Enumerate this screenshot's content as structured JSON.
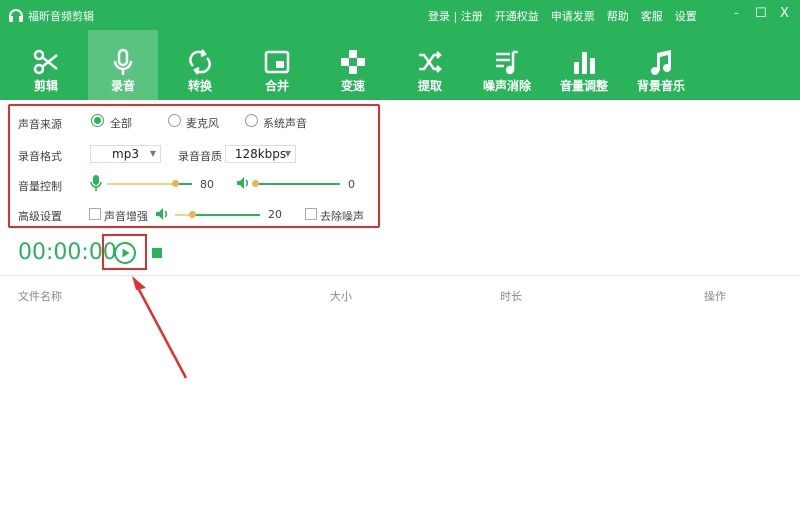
{
  "app": {
    "title": "福昕音频剪辑"
  },
  "header_links": [
    "登录 | 注册",
    "开通权益",
    "申请发票",
    "帮助",
    "客服",
    "设置"
  ],
  "window_controls": {
    "minimize": "-",
    "maximize": "☐",
    "close": "X"
  },
  "tabs": [
    {
      "label": "剪辑"
    },
    {
      "label": "录音"
    },
    {
      "label": "转换"
    },
    {
      "label": "合并"
    },
    {
      "label": "变速"
    },
    {
      "label": "提取"
    },
    {
      "label": "噪声消除"
    },
    {
      "label": "音量调整"
    },
    {
      "label": "背景音乐"
    }
  ],
  "settings": {
    "source": {
      "label": "声音来源",
      "options": [
        "全部",
        "麦克风",
        "系统声音"
      ],
      "selected": "全部"
    },
    "format": {
      "label": "录音格式",
      "value": "mp3",
      "quality_label": "录音音质",
      "quality_value": "128kbps"
    },
    "volume": {
      "label": "音量控制",
      "mic_value": "80",
      "speaker_value": "0",
      "mic_level": 80,
      "speaker_level": 0
    },
    "advanced": {
      "label": "高级设置",
      "enhance_label": "声音增强",
      "enhance_value": "20",
      "enhance_level": 20,
      "denoise_label": "去除噪声"
    }
  },
  "timer": "00:00:00",
  "table": {
    "headers": [
      "文件名称",
      "大小",
      "时长",
      "操作"
    ]
  },
  "colors": {
    "accent": "#2bb35b",
    "highlight": "#d93030"
  }
}
